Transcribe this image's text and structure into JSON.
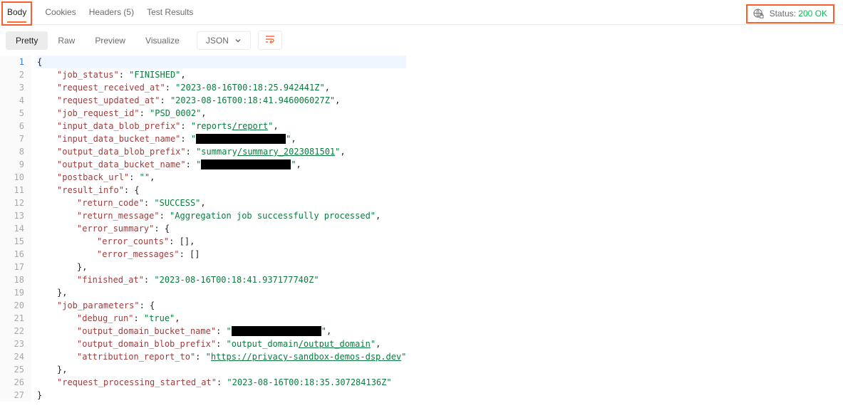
{
  "header": {
    "tabs": [
      {
        "label": "Body",
        "active": true
      },
      {
        "label": "Cookies",
        "active": false
      },
      {
        "label": "Headers (5)",
        "active": false
      },
      {
        "label": "Test Results",
        "active": false
      }
    ],
    "status_label": "Status:",
    "status_value": "200 OK"
  },
  "toolbar": {
    "views": [
      {
        "label": "Pretty",
        "active": true
      },
      {
        "label": "Raw",
        "active": false
      },
      {
        "label": "Preview",
        "active": false
      },
      {
        "label": "Visualize",
        "active": false
      }
    ],
    "format": "JSON"
  },
  "code": {
    "total_lines": 27,
    "lines": {
      "l2_key": "\"job_status\"",
      "l2_val": "\"FINISHED\"",
      "l3_key": "\"request_received_at\"",
      "l3_val": "\"2023-08-16T00:18:25.942441Z\"",
      "l4_key": "\"request_updated_at\"",
      "l4_val": "\"2023-08-16T00:18:41.946006027Z\"",
      "l5_key": "\"job_request_id\"",
      "l5_val": "\"PSD_0002\"",
      "l6_key": "\"input_data_blob_prefix\"",
      "l6_val_a": "\"reports",
      "l6_val_b": "/report",
      "l6_val_c": "\"",
      "l7_key": "\"input_data_bucket_name\"",
      "l8_key": "\"output_data_blob_prefix\"",
      "l8_val_a": "\"summary",
      "l8_val_b": "/summary_2023081501",
      "l8_val_c": "\"",
      "l9_key": "\"output_data_bucket_name\"",
      "l10_key": "\"postback_url\"",
      "l10_val": "\"\"",
      "l11_key": "\"result_info\"",
      "l12_key": "\"return_code\"",
      "l12_val": "\"SUCCESS\"",
      "l13_key": "\"return_message\"",
      "l13_val": "\"Aggregation job successfully processed\"",
      "l14_key": "\"error_summary\"",
      "l15_key": "\"error_counts\"",
      "l15_val": "[]",
      "l16_key": "\"error_messages\"",
      "l16_val": "[]",
      "l18_key": "\"finished_at\"",
      "l18_val": "\"2023-08-16T00:18:41.937177740Z\"",
      "l20_key": "\"job_parameters\"",
      "l21_key": "\"debug_run\"",
      "l21_val": "\"true\"",
      "l22_key": "\"output_domain_bucket_name\"",
      "l23_key": "\"output_domain_blob_prefix\"",
      "l23_val_a": "\"output_domain",
      "l23_val_b": "/output_domain",
      "l23_val_c": "\"",
      "l24_key": "\"attribution_report_to\"",
      "l24_val_a": "\"",
      "l24_val_b": "https://privacy-sandbox-demos-dsp.dev",
      "l24_val_c": "\"",
      "l26_key": "\"request_processing_started_at\"",
      "l26_val": "\"2023-08-16T00:18:35.307284136Z\""
    }
  }
}
